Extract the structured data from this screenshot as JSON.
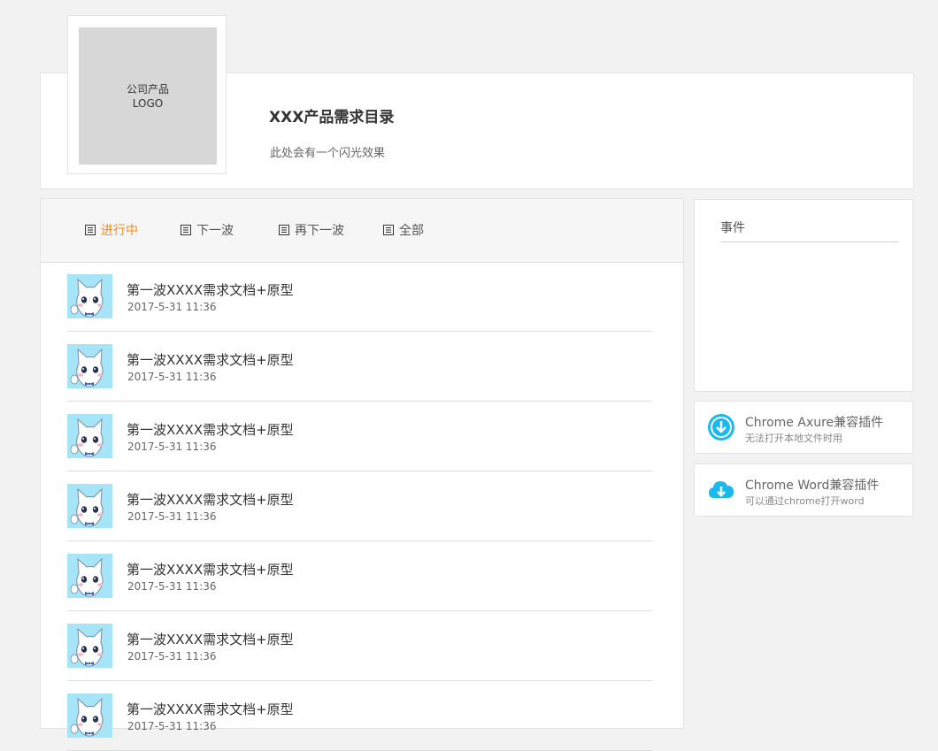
{
  "header": {
    "logo_line1": "公司产品",
    "logo_line2": "LOGO",
    "title": "XXX产品需求目录",
    "subtitle": "此处会有一个闪光效果"
  },
  "tabs": [
    {
      "label": "进行中",
      "active": true
    },
    {
      "label": "下一波",
      "active": false
    },
    {
      "label": "再下一波",
      "active": false
    },
    {
      "label": "全部",
      "active": false
    }
  ],
  "items": [
    {
      "title": "第一波XXXX需求文档+原型",
      "time": "2017-5-31 11:36"
    },
    {
      "title": "第一波XXXX需求文档+原型",
      "time": "2017-5-31 11:36"
    },
    {
      "title": "第一波XXXX需求文档+原型",
      "time": "2017-5-31 11:36"
    },
    {
      "title": "第一波XXXX需求文档+原型",
      "time": "2017-5-31 11:36"
    },
    {
      "title": "第一波XXXX需求文档+原型",
      "time": "2017-5-31 11:36"
    },
    {
      "title": "第一波XXXX需求文档+原型",
      "time": "2017-5-31 11:36"
    },
    {
      "title": "第一波XXXX需求文档+原型",
      "time": "2017-5-31 11:36"
    }
  ],
  "events": {
    "title": "事件"
  },
  "plugins": [
    {
      "title": "Chrome Axure兼容插件",
      "desc": "无法打开本地文件时用",
      "icon": "download-circle-icon"
    },
    {
      "title": "Chrome Word兼容插件",
      "desc": "可以通过chrome打开word",
      "icon": "cloud-download-icon"
    }
  ],
  "colors": {
    "active_tab": "#f08c1f",
    "accent_icon": "#19b9ee",
    "avatar_bg": "#a6e5f7"
  }
}
